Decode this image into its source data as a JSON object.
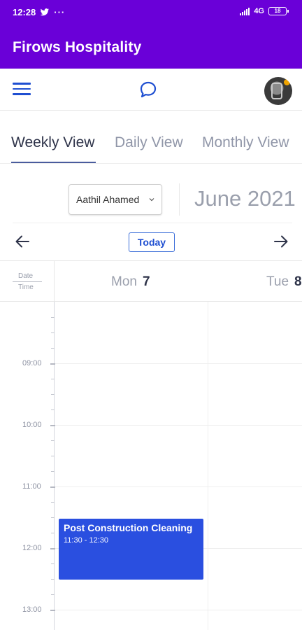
{
  "status_bar": {
    "time": "12:28",
    "dots": "···",
    "network": "4G",
    "battery": "18"
  },
  "app_bar": {
    "title": "Firows Hospitality"
  },
  "tabs": [
    {
      "label": "Weekly View",
      "active": true
    },
    {
      "label": "Daily View",
      "active": false
    },
    {
      "label": "Monthly View",
      "active": false
    }
  ],
  "controls": {
    "user_select": "Aathil Ahamed",
    "month_label": "June 2021",
    "today_label": "Today"
  },
  "calendar": {
    "corner_date": "Date",
    "corner_time": "Time",
    "days": [
      {
        "name": "Mon",
        "number": "7"
      },
      {
        "name": "Tue",
        "number": "8"
      }
    ],
    "hours": [
      "09:00",
      "10:00",
      "11:00",
      "12:00",
      "13:00"
    ],
    "event": {
      "title": "Post Construction Cleaning",
      "time": "11:30 - 12:30"
    }
  },
  "colors": {
    "primary": "#6a00d8",
    "accent": "#1f4fd1",
    "event": "#2a4fe0"
  }
}
